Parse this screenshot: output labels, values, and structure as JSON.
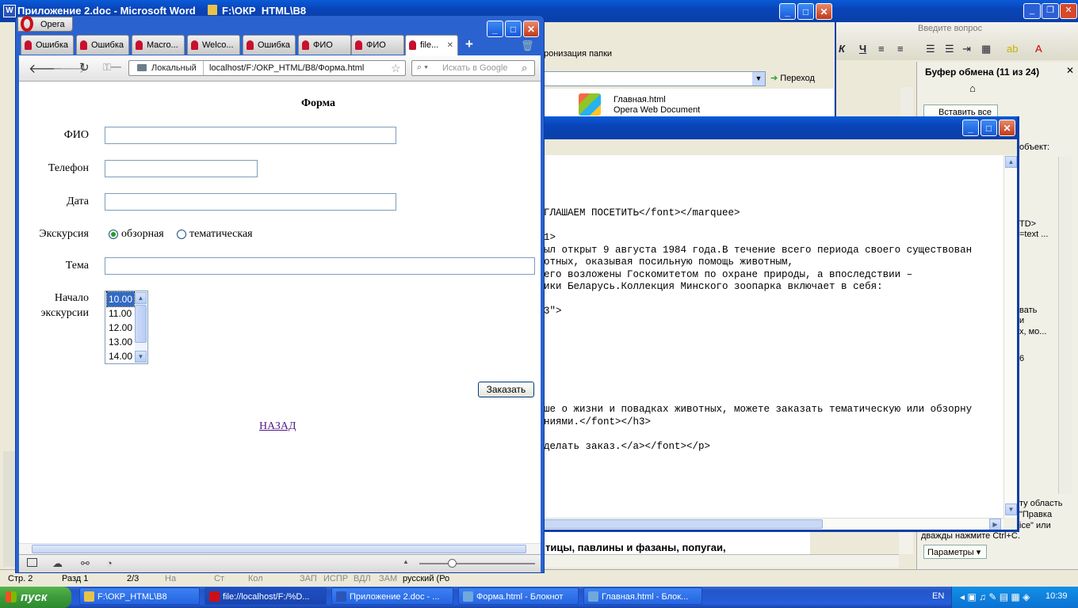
{
  "word": {
    "title": "Приложение 2.doc - Microsoft Word",
    "question_placeholder": "Введите вопрос",
    "clipboard_title": "Буфер обмена (11 из 24)",
    "paste_all": "Вставить все",
    "params": "Параметры",
    "pane_texts": [
      "объект:",
      "TD>",
      "=text ...",
      "вать",
      "и",
      "х, мо...",
      "6",
      "ту область",
      "\"Правка",
      "ice\" или",
      "дважды нажмите Ctrl+C."
    ],
    "doc_line": "тицы, павлины и фазаны, попугаи,",
    "status": [
      "Стр. 2",
      "Разд 1",
      "2/3",
      "На",
      "Ст",
      "Кол",
      "ЗАП",
      "ИСПР",
      "ВДЛ",
      "ЗАМ",
      "русский (Ро"
    ]
  },
  "explorer": {
    "title": "F:\\ОКР_HTML\\В8",
    "sync_text": "ронизация папки",
    "go": "Переход",
    "file_name": "Главная.html",
    "file_type": "Opera Web Document"
  },
  "notepad": {
    "lines": [
      "ГЛАШАЕМ ПОСЕТИТЬ</font></marquee>",
      "",
      "1>",
      "ыл открыт 9 августа 1984 года.В течение всего периода своего существован",
      "отных, оказывая посильную помощь животным,",
      "его возложены Госкомитетом по охране природы, а впоследствии –",
      "ики Беларусь.Коллекция Минского зоопарка включает в себя:",
      "",
      "3\">",
      "",
      "",
      "",
      "",
      "",
      "",
      "",
      "ше о жизни и повадках животных, можете заказать тематическую или обзорну",
      "ниями.</font></h3>",
      "",
      "делать заказ.</a></font></p>"
    ]
  },
  "opera": {
    "menu_label": "Opera",
    "tabs": [
      "Ошибка",
      "Ошибка",
      "Macro...",
      "Welco...",
      "Ошибка",
      "ФИО",
      "ФИО",
      "file..."
    ],
    "local_label": "Локальный",
    "url": "localhost/F:/ОКР_HTML/В8/Форма.html",
    "search_placeholder": "Искать в Google"
  },
  "form": {
    "title": "Форма",
    "fio_label": "ФИО",
    "phone_label": "Телефон",
    "date_label": "Дата",
    "excursion_label": "Экскурсия",
    "radio_1": "обзорная",
    "radio_2": "тематическая",
    "theme_label": "Тема",
    "start_label_1": "Начало",
    "start_label_2": "экскурсии",
    "times": [
      "10.00",
      "11.00",
      "12.00",
      "13.00",
      "14.00"
    ],
    "order_button": "Заказать",
    "back_link": "НАЗАД"
  },
  "taskbar": {
    "start": "пуск",
    "items": [
      "F:\\ОКР_HTML\\В8",
      "file://localhost/F:/%D...",
      "Приложение 2.doc - ...",
      "Форма.html - Блокнот",
      "Главная.html - Блок..."
    ],
    "lang": "EN",
    "clock": "10:39"
  },
  "colors": {
    "xp_blue": "#0a4fd0",
    "start_green": "#3c9a3c",
    "link": "#551a8b"
  }
}
